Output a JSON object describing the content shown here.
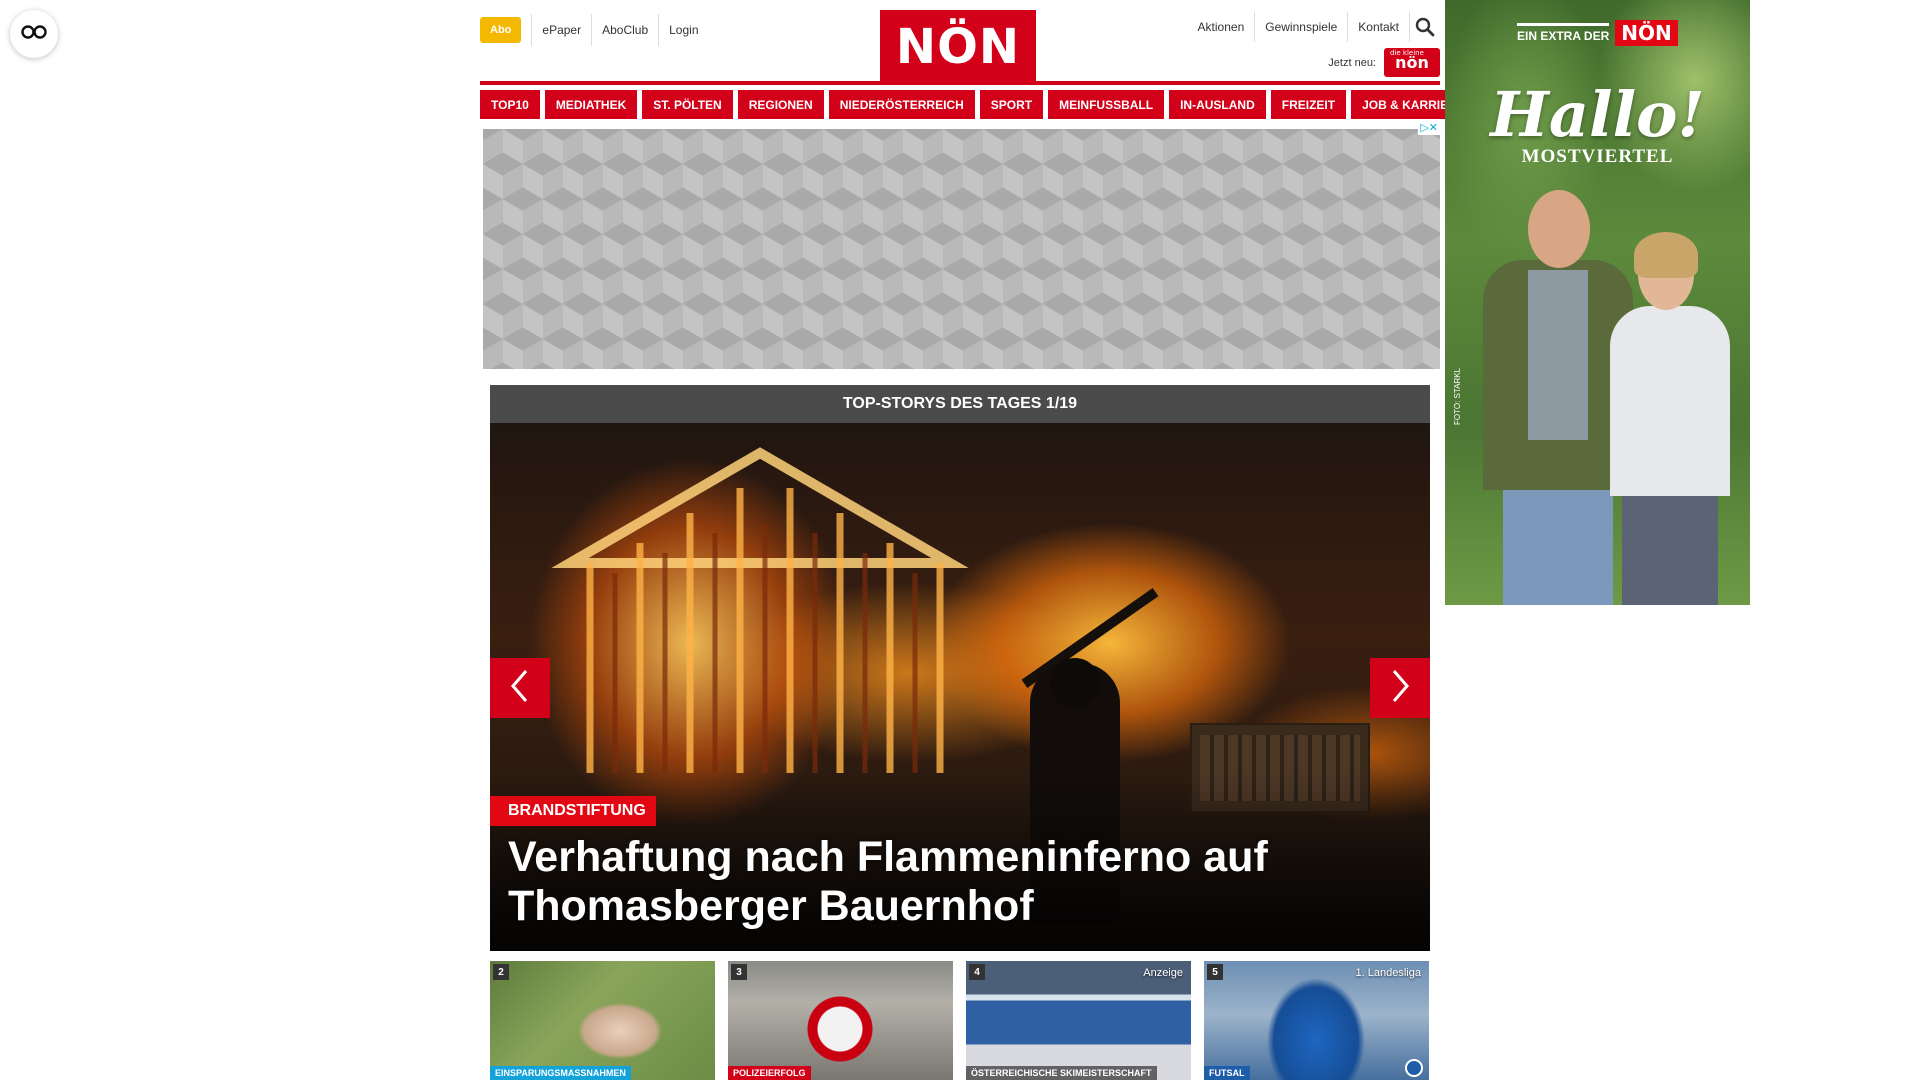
{
  "header": {
    "abo_label": "Abo",
    "left_links": [
      "ePaper",
      "AboClub",
      "Login"
    ],
    "logo_text": "NÖN",
    "right_links": [
      "Aktionen",
      "Gewinnspiele",
      "Kontakt"
    ],
    "jetzt_neu_label": "Jetzt neu:",
    "mini_logo_small": "die kleine",
    "mini_logo_text": "nön"
  },
  "nav": {
    "categories": [
      "TOP10",
      "MEDIATHEK",
      "ST. PÖLTEN",
      "REGIONEN",
      "NIEDERÖSTERREICH",
      "SPORT",
      "MEINFUSSBALL",
      "IN-AUSLAND",
      "FREIZEIT",
      "JOB & KARRIERE"
    ]
  },
  "ad": {
    "badge": "▷✕"
  },
  "slider": {
    "heading": "TOP-STORYS DES TAGES 1/19",
    "tag": "BRANDSTIFTUNG",
    "title": "Verhaftung nach Flammeninferno auf Thomasberger Bauernhof"
  },
  "thumbs": [
    {
      "num": "2",
      "top_label": "",
      "tag": "EINSPARUNGSMASSNAHMEN"
    },
    {
      "num": "3",
      "top_label": "",
      "tag": "POLIZEIERFOLG"
    },
    {
      "num": "4",
      "top_label": "Anzeige",
      "tag": "ÖSTERREICHISCHE SKIMEISTERSCHAFT"
    },
    {
      "num": "5",
      "top_label": "1. Landesliga",
      "tag": "FUTSAL"
    }
  ],
  "sky_ad": {
    "extra_text": "EIN EXTRA DER",
    "extra_logo": "NÖN",
    "hallo": "Hallo!",
    "sub": "MOSTVIERTEL",
    "photo_credit": "FOTO: STARKL"
  },
  "colors": {
    "brand_red": "#d3001a",
    "abo_yellow": "#f5b800",
    "slider_head": "#4b4b4b"
  },
  "icons": {
    "a11y": "glasses-icon",
    "search": "search-icon",
    "prev": "chevron-left-icon",
    "next": "chevron-right-icon"
  }
}
